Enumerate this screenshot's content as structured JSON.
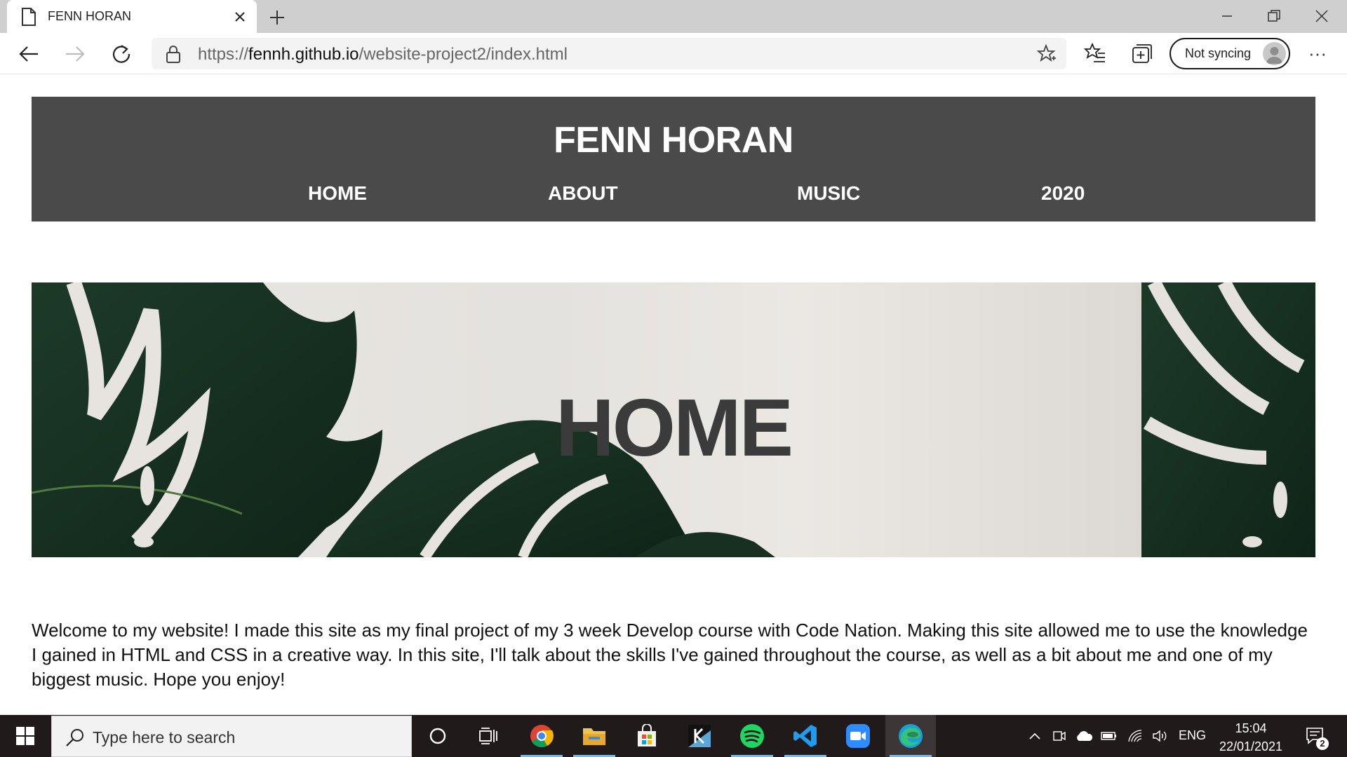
{
  "browser": {
    "tab_title": "FENN HORAN",
    "url_prefix": "https://",
    "url_host": "fennh.github.io",
    "url_path": "/website-project2/index.html",
    "profile_label": "Not syncing",
    "more_label": "···"
  },
  "site": {
    "title": "FENN HORAN",
    "nav": [
      "HOME",
      "ABOUT",
      "MUSIC",
      "2020"
    ],
    "hero_title": "HOME",
    "intro": "Welcome to my website! I made this site as my final project of my 3 week Develop course with Code Nation. Making this site allowed me to use the knowledge I gained in HTML and CSS in a creative way. In this site, I'll talk about the skills I've gained throughout the course, as well as a bit about me and one of my biggest music. Hope you enjoy!"
  },
  "taskbar": {
    "search_placeholder": "Type here to search",
    "apps": [
      "cortana-icon",
      "task-view-icon",
      "chrome-icon",
      "file-explorer-icon",
      "microsoft-store-icon",
      "kindle-icon",
      "spotify-icon",
      "vscode-icon",
      "zoom-icon",
      "edge-icon"
    ],
    "language": "ENG",
    "time": "15:04",
    "date": "22/01/2021",
    "notification_count": "2"
  },
  "colors": {
    "header_bg": "#4a4a4a",
    "leaf": "#1f3a2a",
    "taskbar_bg": "#201a1a",
    "accent": "#76b9ed"
  }
}
